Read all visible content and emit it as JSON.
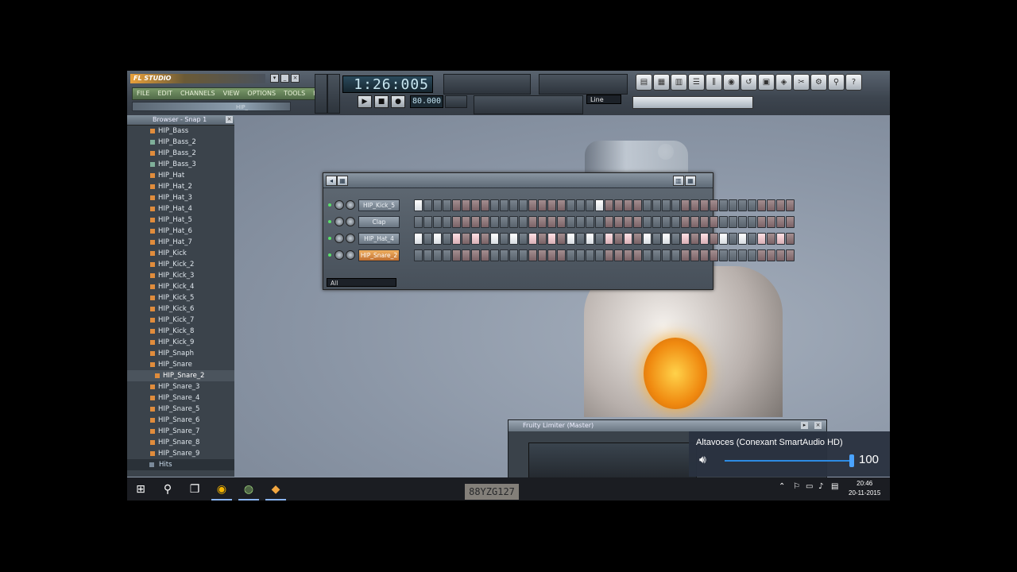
{
  "app": {
    "logo": "FL STUDIO",
    "menu": [
      "FILE",
      "EDIT",
      "CHANNELS",
      "VIEW",
      "OPTIONS",
      "TOOLS",
      "HELP"
    ],
    "hint": "HIP_",
    "time": "1:26:005",
    "tempo": "80.000",
    "snap_mode": "Line"
  },
  "browser": {
    "title": "Browser - Snap 1",
    "items": [
      {
        "label": "HIP_Bass",
        "type": "sample"
      },
      {
        "label": "HIP_Bass_2",
        "type": "synth"
      },
      {
        "label": "HIP_Bass_2",
        "type": "sample"
      },
      {
        "label": "HIP_Bass_3",
        "type": "synth"
      },
      {
        "label": "HIP_Hat",
        "type": "sample"
      },
      {
        "label": "HIP_Hat_2",
        "type": "sample"
      },
      {
        "label": "HIP_Hat_3",
        "type": "sample"
      },
      {
        "label": "HIP_Hat_4",
        "type": "sample"
      },
      {
        "label": "HIP_Hat_5",
        "type": "sample"
      },
      {
        "label": "HIP_Hat_6",
        "type": "sample"
      },
      {
        "label": "HIP_Hat_7",
        "type": "sample"
      },
      {
        "label": "HIP_Kick",
        "type": "sample"
      },
      {
        "label": "HIP_Kick_2",
        "type": "sample"
      },
      {
        "label": "HIP_Kick_3",
        "type": "sample"
      },
      {
        "label": "HIP_Kick_4",
        "type": "sample"
      },
      {
        "label": "HIP_Kick_5",
        "type": "sample"
      },
      {
        "label": "HIP_Kick_6",
        "type": "sample"
      },
      {
        "label": "HIP_Kick_7",
        "type": "sample"
      },
      {
        "label": "HIP_Kick_8",
        "type": "sample"
      },
      {
        "label": "HIP_Kick_9",
        "type": "sample"
      },
      {
        "label": "HIP_Snaph",
        "type": "sample"
      },
      {
        "label": "HIP_Snare",
        "type": "sample"
      },
      {
        "label": "HIP_Snare_2",
        "type": "sample",
        "selected": true
      },
      {
        "label": "HIP_Snare_3",
        "type": "sample"
      },
      {
        "label": "HIP_Snare_4",
        "type": "sample"
      },
      {
        "label": "HIP_Snare_5",
        "type": "sample"
      },
      {
        "label": "HIP_Snare_6",
        "type": "sample"
      },
      {
        "label": "HIP_Snare_7",
        "type": "sample"
      },
      {
        "label": "HIP_Snare_8",
        "type": "sample"
      },
      {
        "label": "HIP_Snare_9",
        "type": "sample"
      },
      {
        "label": "Hits",
        "type": "folder"
      }
    ]
  },
  "sequencer": {
    "channels": [
      {
        "name": "HIP_Kick_5",
        "pattern": "1000000000000000000100000000000000000000"
      },
      {
        "name": "Clap",
        "pattern": "0000000000000000000000000000000000000000"
      },
      {
        "name": "HIP_Hat_4",
        "pattern": "1010101010101010101010101010101010101010"
      },
      {
        "name": "HIP_Snare_2",
        "pattern": "0000000000000000000000000000000000000000",
        "active": true
      }
    ],
    "filter": "All"
  },
  "limiter": {
    "title": "Fruity Limiter (Master)"
  },
  "volume": {
    "device": "Altavoces (Conexant SmartAudio HD)",
    "level": "100"
  },
  "taskbar": {
    "time": "20:46",
    "date": "20-11-2015"
  },
  "background": {
    "plate_text": "88YZG127"
  }
}
